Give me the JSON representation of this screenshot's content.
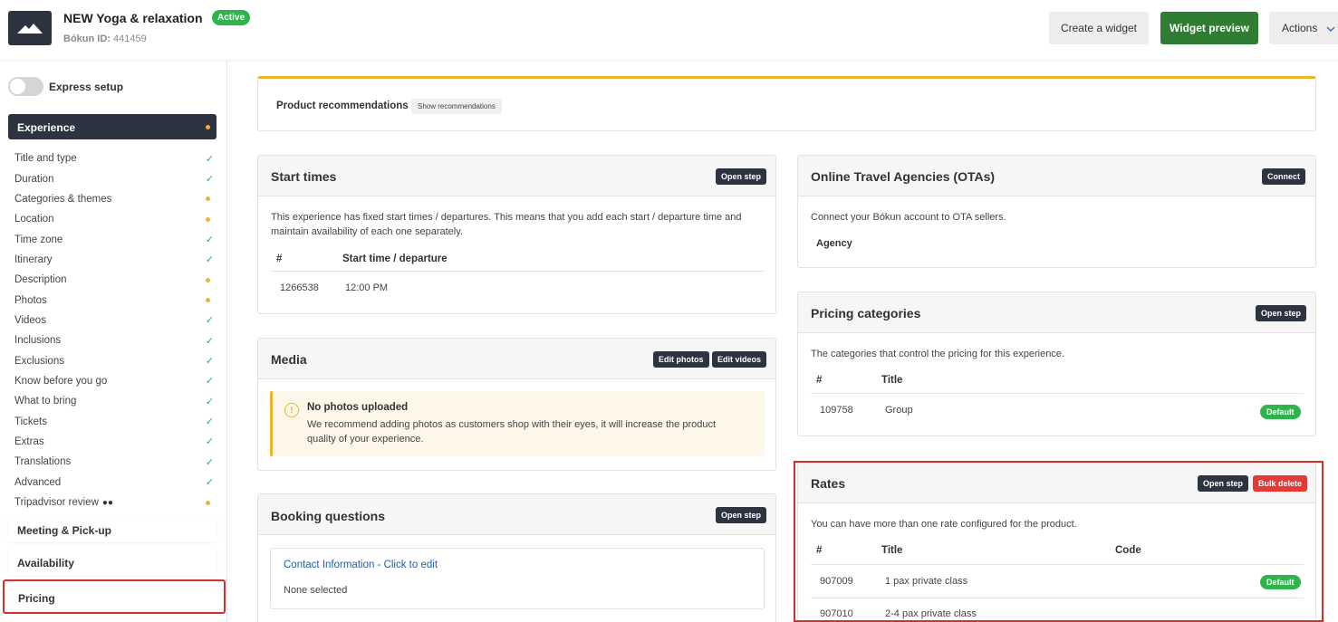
{
  "header": {
    "product_title": "NEW Yoga & relaxation",
    "status": "Active",
    "id_label": "Bókun ID:",
    "id_value": "441459",
    "create_widget": "Create a widget",
    "widget_preview": "Widget preview",
    "actions": "Actions"
  },
  "sidebar": {
    "express_setup": "Express setup",
    "experience": "Experience",
    "steps": [
      {
        "label": "Title and type",
        "status": "done"
      },
      {
        "label": "Duration",
        "status": "done"
      },
      {
        "label": "Categories & themes",
        "status": "pending"
      },
      {
        "label": "Location",
        "status": "pending"
      },
      {
        "label": "Time zone",
        "status": "done"
      },
      {
        "label": "Itinerary",
        "status": "done"
      },
      {
        "label": "Description",
        "status": "pending"
      },
      {
        "label": "Photos",
        "status": "pending"
      },
      {
        "label": "Videos",
        "status": "done"
      },
      {
        "label": "Inclusions",
        "status": "done"
      },
      {
        "label": "Exclusions",
        "status": "done"
      },
      {
        "label": "Know before you go",
        "status": "done"
      },
      {
        "label": "What to bring",
        "status": "done"
      },
      {
        "label": "Tickets",
        "status": "done"
      },
      {
        "label": "Extras",
        "status": "done"
      },
      {
        "label": "Translations",
        "status": "done"
      },
      {
        "label": "Advanced",
        "status": "done"
      },
      {
        "label": "Tripadvisor review",
        "status": "pending"
      }
    ],
    "sections": {
      "meeting": "Meeting & Pick-up",
      "availability": "Availability",
      "pricing": "Pricing"
    }
  },
  "recommendations": {
    "label": "Product recommendations",
    "button": "Show recommendations"
  },
  "start_times": {
    "title": "Start times",
    "button": "Open step",
    "description": "This experience has fixed start times / departures. This means that you add each start / departure time and maintain availability of each one separately.",
    "col_id": "#",
    "col_time": "Start time / departure",
    "rows": [
      {
        "id": "1266538",
        "time": "12:00 PM"
      }
    ]
  },
  "media": {
    "title": "Media",
    "edit_photos": "Edit photos",
    "edit_videos": "Edit videos",
    "warning_title": "No photos uploaded",
    "warning_text": "We recommend adding photos as customers shop with their eyes, it will increase the product quality of your experience."
  },
  "booking_questions": {
    "title": "Booking questions",
    "button": "Open step",
    "contact_link": "Contact Information - Click to edit",
    "contact_value": "None selected"
  },
  "ota": {
    "title": "Online Travel Agencies (OTAs)",
    "button": "Connect",
    "description": "Connect your Bókun account to OTA sellers.",
    "agency_label": "Agency"
  },
  "pricing_categories": {
    "title": "Pricing categories",
    "button": "Open step",
    "description": "The categories that control the pricing for this experience.",
    "col_id": "#",
    "col_title": "Title",
    "rows": [
      {
        "id": "109758",
        "title": "Group",
        "badge": "Default"
      }
    ]
  },
  "rates": {
    "title": "Rates",
    "open_step": "Open step",
    "bulk_delete": "Bulk delete",
    "description": "You can have more than one rate configured for the product.",
    "col_id": "#",
    "col_title": "Title",
    "col_code": "Code",
    "rows": [
      {
        "id": "907009",
        "title": "1 pax private class",
        "badge": "Default"
      },
      {
        "id": "907010",
        "title": "2-4 pax private class"
      }
    ]
  }
}
